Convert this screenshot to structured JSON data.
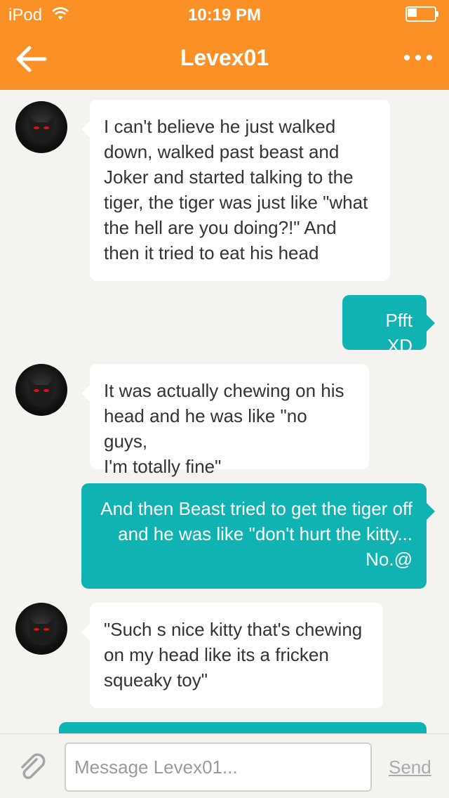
{
  "status_bar": {
    "carrier": "iPod",
    "time": "10:19 PM",
    "battery_level": 0.35
  },
  "header": {
    "title": "Levex01",
    "back_icon": "arrow-left-icon",
    "more_icon": "ellipsis-icon"
  },
  "colors": {
    "header": "#fb9027",
    "outgoing": "#10b3b2",
    "incoming": "#ffffff",
    "background": "#f4f3ef"
  },
  "messages": [
    {
      "from": "Levex01",
      "direction": "in",
      "text": "I can't believe he just walked\ndown, walked past beast and\nJoker and started talking to the\ntiger, the tiger was just like \"what\nthe hell are you doing?!\" And\nthen it tried to eat his head"
    },
    {
      "from": "me",
      "direction": "out",
      "text": "Pfft XD"
    },
    {
      "from": "Levex01",
      "direction": "in",
      "text": "It was actually chewing on his\nhead and he was like \"no guys,\nI'm totally fine\""
    },
    {
      "from": "me",
      "direction": "out",
      "text": "And then Beast tried to get the tiger off\nand he was like \"don't hurt the kitty...\nNo.@"
    },
    {
      "from": "Levex01",
      "direction": "in",
      "text": "\"Such s nice kitty that's chewing\non my head like its a fricken\nsqueaky toy\""
    },
    {
      "from": "me",
      "direction": "out",
      "text": ""
    }
  ],
  "composer": {
    "placeholder": "Message Levex01...",
    "value": "",
    "send_label": "Send",
    "attach_icon": "paperclip-icon"
  }
}
